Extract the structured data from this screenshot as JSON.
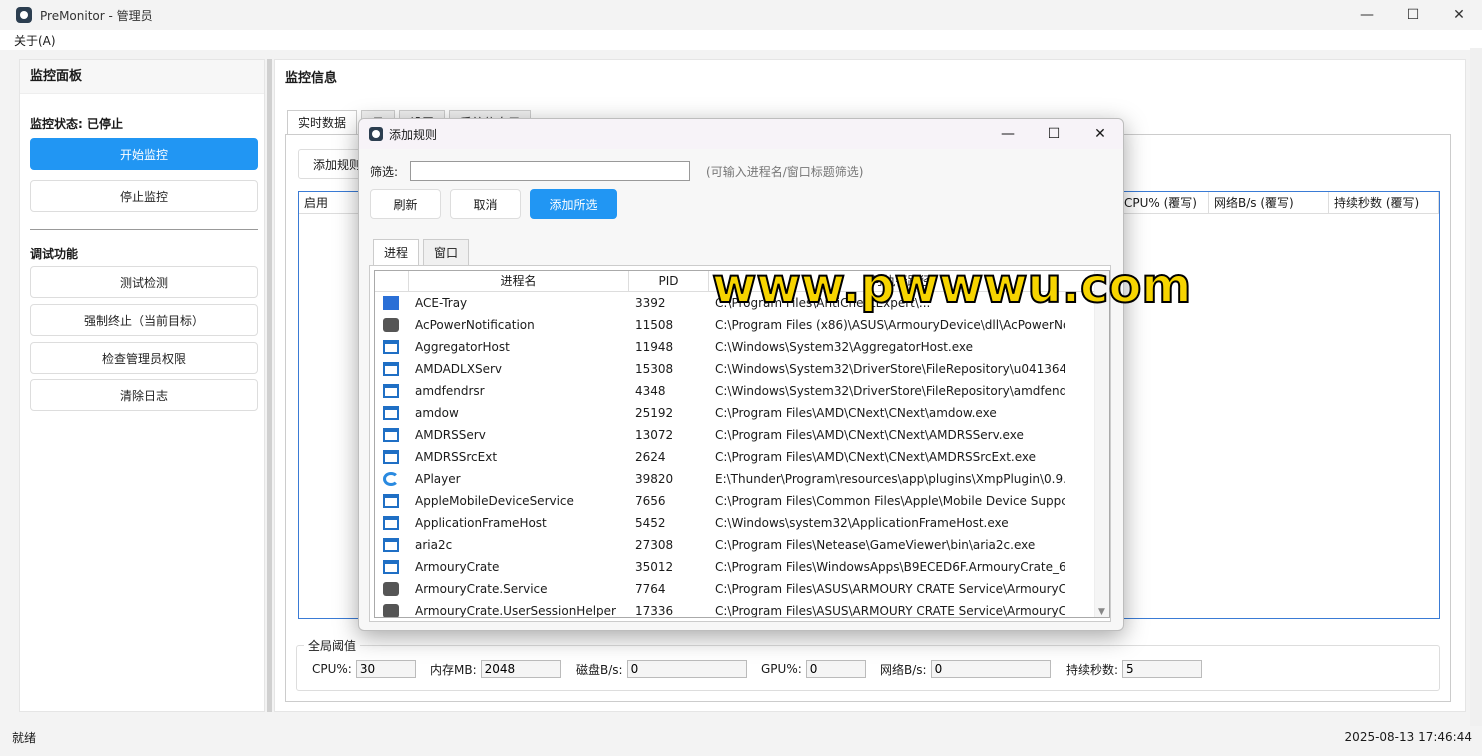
{
  "window": {
    "title": "PreMonitor - 管理员",
    "controls": {
      "minimize": "—",
      "maximize": "☐",
      "close": "✕"
    }
  },
  "menu": {
    "about": "关于(A)"
  },
  "left": {
    "title": "监控面板",
    "status": "监控状态: 已停止",
    "start": "开始监控",
    "stop": "停止监控",
    "debug_title": "调试功能",
    "debug_buttons": [
      "测试检测",
      "强制终止（当前目标）",
      "检查管理员权限",
      "清除日志"
    ]
  },
  "right": {
    "title": "监控信息",
    "tabs": [
      "实时数据",
      "日",
      "设置",
      "系统信息用"
    ],
    "add_rule": "添加规则",
    "columns": [
      "启用",
      "CPU% (覆写)",
      "网络B/s (覆写)",
      "持续秒数 (覆写)"
    ],
    "threshold_title": "全局阈值",
    "thresholds": [
      {
        "label": "CPU%:",
        "value": "30"
      },
      {
        "label": "内存MB:",
        "value": "2048"
      },
      {
        "label": "磁盘B/s:",
        "value": "0"
      },
      {
        "label": "GPU%:",
        "value": "0"
      },
      {
        "label": "网络B/s:",
        "value": "0"
      },
      {
        "label": "持续秒数:",
        "value": "5"
      }
    ]
  },
  "statusbar": {
    "left": "就绪",
    "right": "2025-08-13 17:46:44"
  },
  "dialog": {
    "title": "添加规则",
    "filter_label": "筛选:",
    "filter_value": "",
    "filter_hint": "(可输入进程名/窗口标题筛选)",
    "refresh": "刷新",
    "cancel": "取消",
    "add_selected": "添加所选",
    "tabs": [
      "进程",
      "窗口"
    ],
    "columns": [
      "进程名",
      "PID",
      "可执行路径"
    ],
    "rows": [
      {
        "icon": "blue",
        "name": "ACE-Tray",
        "pid": "3392",
        "path": "C:\\Program Files\\AntiCheatExpert\\..."
      },
      {
        "icon": "dark",
        "name": "AcPowerNotification",
        "pid": "11508",
        "path": "C:\\Program Files (x86)\\ASUS\\ArmouryDevice\\dll\\AcPowerNo"
      },
      {
        "icon": "win",
        "name": "AggregatorHost",
        "pid": "11948",
        "path": "C:\\Windows\\System32\\AggregatorHost.exe"
      },
      {
        "icon": "win",
        "name": "AMDADLXServ",
        "pid": "15308",
        "path": "C:\\Windows\\System32\\DriverStore\\FileRepository\\u0413647"
      },
      {
        "icon": "win",
        "name": "amdfendrsr",
        "pid": "4348",
        "path": "C:\\Windows\\System32\\DriverStore\\FileRepository\\amdfendr"
      },
      {
        "icon": "win",
        "name": "amdow",
        "pid": "25192",
        "path": "C:\\Program Files\\AMD\\CNext\\CNext\\amdow.exe"
      },
      {
        "icon": "win",
        "name": "AMDRSServ",
        "pid": "13072",
        "path": "C:\\Program Files\\AMD\\CNext\\CNext\\AMDRSServ.exe"
      },
      {
        "icon": "win",
        "name": "AMDRSSrcExt",
        "pid": "2624",
        "path": "C:\\Program Files\\AMD\\CNext\\CNext\\AMDRSSrcExt.exe"
      },
      {
        "icon": "swirl",
        "name": "APlayer",
        "pid": "39820",
        "path": "E:\\Thunder\\Program\\resources\\app\\plugins\\XmpPlugin\\0.9."
      },
      {
        "icon": "win",
        "name": "AppleMobileDeviceService",
        "pid": "7656",
        "path": "C:\\Program Files\\Common Files\\Apple\\Mobile Device Suppc"
      },
      {
        "icon": "win",
        "name": "ApplicationFrameHost",
        "pid": "5452",
        "path": "C:\\Windows\\system32\\ApplicationFrameHost.exe"
      },
      {
        "icon": "win",
        "name": "aria2c",
        "pid": "27308",
        "path": "C:\\Program Files\\Netease\\GameViewer\\bin\\aria2c.exe"
      },
      {
        "icon": "win",
        "name": "ArmouryCrate",
        "pid": "35012",
        "path": "C:\\Program Files\\WindowsApps\\B9ECED6F.ArmouryCrate_6."
      },
      {
        "icon": "dark",
        "name": "ArmouryCrate.Service",
        "pid": "7764",
        "path": "C:\\Program Files\\ASUS\\ARMOURY CRATE Service\\ArmouryC"
      },
      {
        "icon": "dark",
        "name": "ArmouryCrate.UserSessionHelper",
        "pid": "17336",
        "path": "C:\\Program Files\\ASUS\\ARMOURY CRATE Service\\ArmouryC"
      }
    ]
  },
  "watermark": "www.pwwwu.com"
}
